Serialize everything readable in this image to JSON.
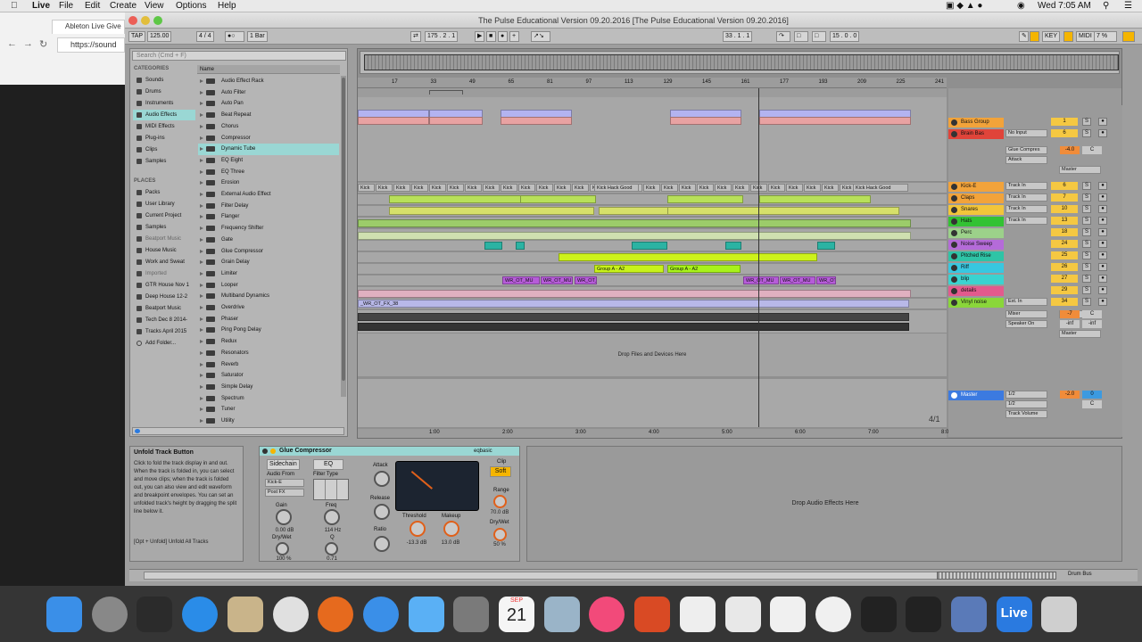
{
  "menubar": {
    "app": "Live",
    "items": [
      "File",
      "Edit",
      "Create",
      "View",
      "Options",
      "Help"
    ],
    "clock": "Wed 7:05 AM"
  },
  "chrome": {
    "tab": "Ableton Live Give",
    "url": "https://sound"
  },
  "window": {
    "title": "The Pulse Educational Version 09.20.2016  [The Pulse Educational Version 09.20.2016]"
  },
  "transport": {
    "tap": "TAP",
    "tempo": "125.00",
    "signature": "4  /  4",
    "quant": "1 Bar",
    "position": "175 .  2 .  1",
    "loop_start": "33 .  1 .  1",
    "loop_len": "15 .  0 .  0",
    "key": "KEY",
    "midi": "MIDI",
    "cpu": "7 %"
  },
  "browser": {
    "search_placeholder": "Search (Cmd + F)",
    "categories_header": "CATEGORIES",
    "categories": [
      "Sounds",
      "Drums",
      "Instruments",
      "Audio Effects",
      "MIDI Effects",
      "Plug-ins",
      "Clips",
      "Samples"
    ],
    "places_header": "PLACES",
    "places": [
      "Packs",
      "User Library",
      "Current Project",
      "Samples",
      "Beatport Music",
      "House Music",
      "Work and Sweat",
      "Imported",
      "GTR House Nov 1",
      "Deep House 12-2",
      "Beatport Music",
      "Tech Dec 8 2014-",
      "Tracks April 2015",
      "Add Folder..."
    ],
    "name_header": "Name",
    "items": [
      "Audio Effect Rack",
      "Auto Filter",
      "Auto Pan",
      "Beat Repeat",
      "Chorus",
      "Compressor",
      "Dynamic Tube",
      "EQ Eight",
      "EQ Three",
      "Erosion",
      "External Audio Effect",
      "Filter Delay",
      "Flanger",
      "Frequency Shifter",
      "Gate",
      "Glue Compressor",
      "Grain Delay",
      "Limiter",
      "Looper",
      "Multiband Dynamics",
      "Overdrive",
      "Phaser",
      "Ping Pong Delay",
      "Redux",
      "Resonators",
      "Reverb",
      "Saturator",
      "Simple Delay",
      "Spectrum",
      "Tuner",
      "Utility"
    ]
  },
  "arrangement": {
    "ruler": [
      "17",
      "33",
      "49",
      "65",
      "81",
      "97",
      "113",
      "129",
      "145",
      "161",
      "177",
      "193",
      "209",
      "225",
      "241"
    ],
    "time_ruler": [
      "1:00",
      "2:00",
      "3:00",
      "4:00",
      "5:00",
      "6:00",
      "7:00",
      "8:00"
    ],
    "drop_text": "Drop Files and Devices Here",
    "page": "4/1",
    "clip_group_a": "Group A - A2",
    "clip_kick": "Kick",
    "clip_kick_hack": "Kick Hack Good",
    "clip_wr": "WR_OT_MU",
    "clip_fx": "_WR_OT_FX_38"
  },
  "tracks": [
    {
      "name": "Bass Group",
      "color": "#f2a33a",
      "in": "",
      "num": "1"
    },
    {
      "name": "Brain Bas",
      "color": "#e0443a",
      "in": "No Input",
      "num": "6"
    },
    {
      "name": "Kick-E",
      "color": "#f2a33a",
      "in": "Track In",
      "num": "6"
    },
    {
      "name": "Claps",
      "color": "#f2a33a",
      "in": "Track In",
      "num": "7"
    },
    {
      "name": "Snares",
      "color": "#f2c53a",
      "in": "Track In",
      "num": "10"
    },
    {
      "name": "Hats",
      "color": "#33c233",
      "in": "Track In",
      "num": "13"
    },
    {
      "name": "Perc",
      "color": "#9cd18a",
      "in": "",
      "num": "18"
    },
    {
      "name": "Noise Sweep",
      "color": "#b56bd9",
      "in": "",
      "num": "24"
    },
    {
      "name": "Pitched Rise",
      "color": "#2ec4a6",
      "in": "",
      "num": "25"
    },
    {
      "name": "Riff",
      "color": "#38c7e0",
      "in": "",
      "num": "26"
    },
    {
      "name": "blip",
      "color": "#3ad3d0",
      "in": "",
      "num": "27"
    },
    {
      "name": "details",
      "color": "#e35a8d",
      "in": "",
      "num": "29"
    },
    {
      "name": "Vinyl noise",
      "color": "#8ad63a",
      "in": "Ext. In",
      "num": "34"
    }
  ],
  "mixer": {
    "glue": "Glue Compres",
    "attack": "Attack",
    "master_out": "Master",
    "vol_a": "-4.0",
    "pan_c": "C",
    "inf": "-inf",
    "mixer_lbl": "Mixer",
    "speaker": "Speaker On",
    "in_lbl": "In",
    "auto_lbl": "Auto",
    "off_lbl": "Off",
    "master": "Master",
    "half": "1/2",
    "track_volume": "Track Volume",
    "master_vol": "-2.0",
    "master_num": "0",
    "vinyl_vol": "-7"
  },
  "info": {
    "title": "Unfold Track Button",
    "body": "Click to fold the track display in and out. When the track is folded in, you can select and move clips; when the track is folded out, you can also view and edit waveform and breakpoint envelopes. You can set an unfolded track's height by dragging the split line below it.",
    "shortcut": "[Opt + Unfold] Unfold All Tracks"
  },
  "device": {
    "name": "Glue Compressor",
    "preset": "eqbasic",
    "sidechain": "Sidechain",
    "eq": "EQ",
    "audio_from": "Audio From",
    "source": "Kick-E",
    "post": "Post FX",
    "filter_type": "Filter Type",
    "attack": "Attack",
    "release": "Release",
    "ratio": "Ratio",
    "clip": "Clip",
    "soft": "Soft",
    "gain_lbl": "Gain",
    "gain": "0.00 dB",
    "freq_lbl": "Freq",
    "freq": "114 Hz",
    "drywet_lbl": "Dry/Wet",
    "drywet": "100 %",
    "q_lbl": "Q",
    "q": "0.71",
    "threshold_lbl": "Threshold",
    "threshold": "-13.3 dB",
    "makeup_lbl": "Makeup",
    "makeup": "13.0 dB",
    "range_lbl": "Range",
    "range": "70.0 dB",
    "dw2": "50 %"
  },
  "dropfx": "Drop Audio Effects Here",
  "statusbar": {
    "right": "Drum Bus"
  },
  "dock": [
    {
      "name": "finder",
      "color": "#3a8fe8"
    },
    {
      "name": "launchpad",
      "color": "#888888"
    },
    {
      "name": "activity",
      "color": "#2b2b2b"
    },
    {
      "name": "appstore",
      "color": "#2a8ce8"
    },
    {
      "name": "preview",
      "color": "#c9b48a"
    },
    {
      "name": "chrome",
      "color": "#e0e0e0"
    },
    {
      "name": "firefox",
      "color": "#e66a1e"
    },
    {
      "name": "safari",
      "color": "#3a8fe8"
    },
    {
      "name": "messages",
      "color": "#5ab0f5"
    },
    {
      "name": "sysprefs",
      "color": "#7a7a7a"
    },
    {
      "name": "calendar",
      "color": "#f5f5f5"
    },
    {
      "name": "iphoto",
      "color": "#9ab4c8"
    },
    {
      "name": "itunes",
      "color": "#f24a7a"
    },
    {
      "name": "office",
      "color": "#d94a24"
    },
    {
      "name": "textedit",
      "color": "#eeeeee"
    },
    {
      "name": "keynote",
      "color": "#e8e8e8"
    },
    {
      "name": "numbers",
      "color": "#f0f0f0"
    },
    {
      "name": "photos",
      "color": "#f0f0f0"
    },
    {
      "name": "uad",
      "color": "#222222"
    },
    {
      "name": "uad2",
      "color": "#222222"
    },
    {
      "name": "mixer",
      "color": "#5a7ab8"
    },
    {
      "name": "live",
      "color": "#2a7ae0"
    },
    {
      "name": "trash",
      "color": "#cfcfcf"
    }
  ],
  "dock_live": "Live",
  "dock_cal_month": "SEP",
  "dock_cal_day": "21"
}
